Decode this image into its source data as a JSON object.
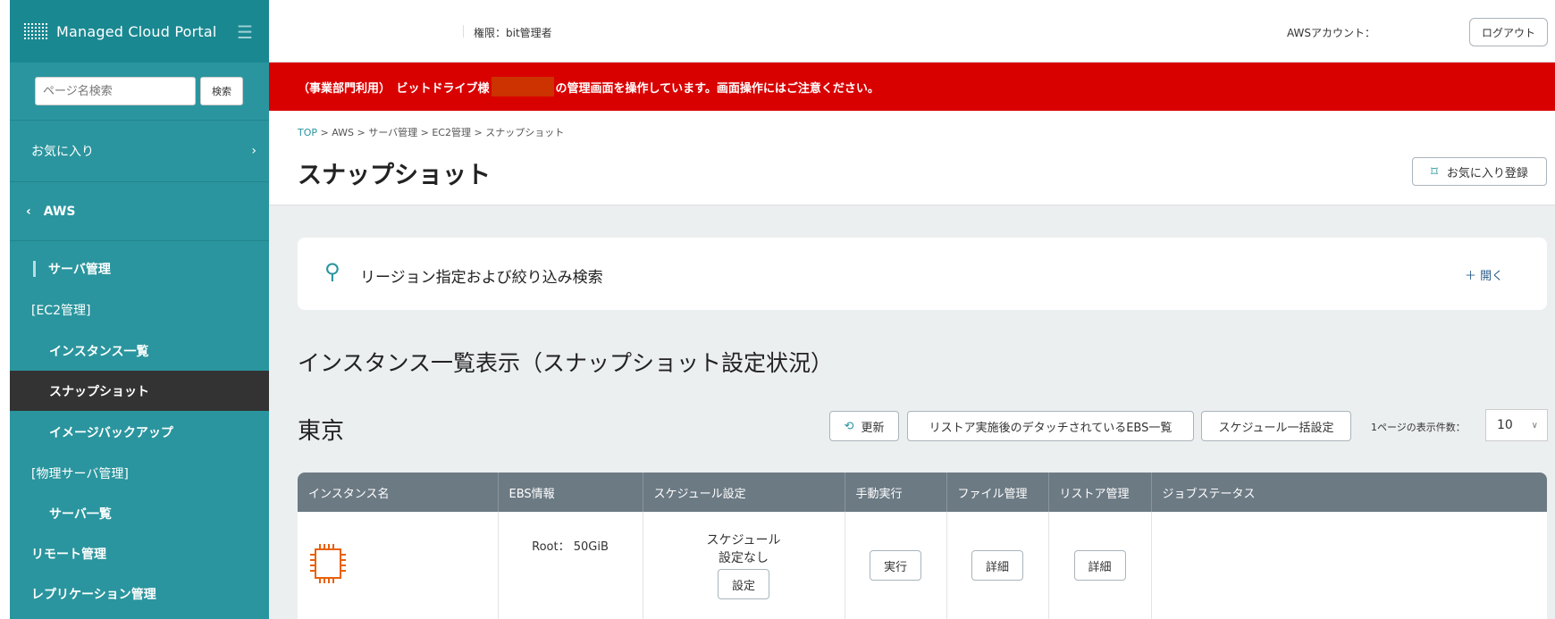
{
  "sidebar": {
    "app_title": "Managed Cloud Portal",
    "search_placeholder": "ページ名検索",
    "search_button": "検索",
    "favorites": "お気に入り",
    "aws": "AWS",
    "items": [
      {
        "label": "サーバ管理"
      },
      {
        "label": "[EC2管理]"
      },
      {
        "label": "インスタンス一覧"
      },
      {
        "label": "スナップショット",
        "active": true
      },
      {
        "label": "イメージバックアップ"
      },
      {
        "label": "[物理サーバ管理]"
      },
      {
        "label": "サーバ一覧"
      },
      {
        "label": "リモート管理"
      },
      {
        "label": "レプリケーション管理"
      }
    ]
  },
  "header": {
    "role": "権限：bit管理者",
    "aws_account": "AWSアカウント：",
    "logout": "ログアウト"
  },
  "banner": {
    "prefix": "（事業部門利用）　ビットドライブ様",
    "suffix": "の管理画面を操作しています。画面操作にはご注意ください。",
    "color": "#d90000"
  },
  "breadcrumb": [
    "TOP",
    "AWS",
    "サーバ管理",
    "EC2管理",
    "スナップショット"
  ],
  "page_title": "スナップショット",
  "favorite_button": "お気に入り登録",
  "filter": {
    "label": "リージョン指定および絞り込み検索",
    "toggle": "＋ 開く"
  },
  "section_title": "インスタンス一覧表示（スナップショット設定状況）",
  "region": "東京",
  "toolbar": {
    "refresh": "更新",
    "detached_ebs": "リストア実施後のデタッチされているEBS一覧",
    "bulk_schedule": "スケジュール一括設定",
    "per_page_label": "1ページの表示件数：",
    "per_page_value": "10"
  },
  "table": {
    "columns": [
      "インスタンス名",
      "EBS情報",
      "スケジュール設定",
      "手動実行",
      "ファイル管理",
      "リストア管理",
      "ジョブステータス"
    ],
    "rows": [
      {
        "ebs": "Root：  50GiB",
        "schedule_line1": "スケジュール",
        "schedule_line2": "設定なし",
        "schedule_button": "設定",
        "run_button": "実行",
        "file_button": "詳細",
        "restore_button": "詳細",
        "job_status": ""
      }
    ]
  }
}
